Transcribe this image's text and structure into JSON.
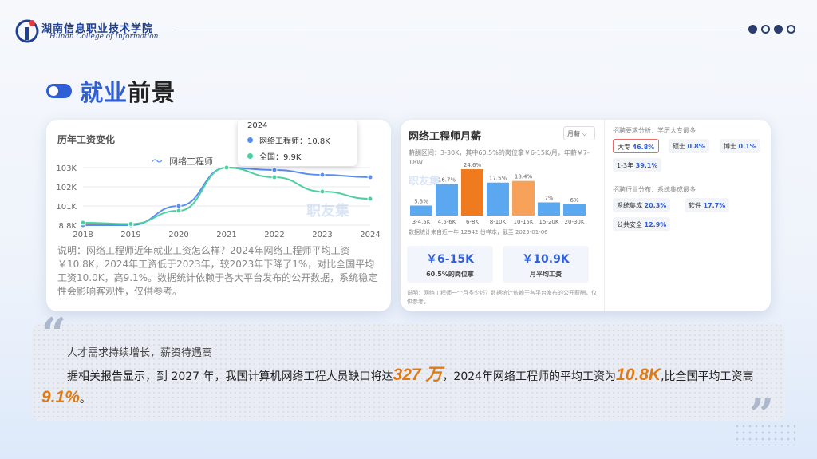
{
  "header": {
    "school_cn": "湖南信息职业技术学院",
    "school_en": "Hunan College of Information",
    "page_dots": 4,
    "active_dot_index": 2
  },
  "title": {
    "highlight": "就业",
    "rest": "前景"
  },
  "salary_trend": {
    "title": "历年工资变化",
    "legend": "网络工程师",
    "tooltip": {
      "year": "2024",
      "row1": "网络工程师：10.8K",
      "row2": "全国：9.9K"
    },
    "watermark": "职友集",
    "description": "说明：网络工程师近年就业工资怎么样？2024年网络工程师平均工资￥10.8K，2024年工资低于2023年，较2023年下降了1%，对比全国平均工资10.0K，高9.1%。数据统计依赖于各大平台发布的公开数据，系统稳定性会影响客观性，仅供参考。"
  },
  "chart_data": [
    {
      "type": "line",
      "title": "历年工资变化",
      "x": [
        "2018",
        "2019",
        "2020",
        "2021",
        "2022",
        "2023",
        "2024"
      ],
      "yticks": [
        "8.8K",
        "101K",
        "102K",
        "103K"
      ],
      "series": [
        {
          "name": "网络工程师",
          "values": [
            8.8,
            8.8,
            9.6,
            11.2,
            11.1,
            10.9,
            10.8
          ],
          "color": "#5b8ef0"
        },
        {
          "name": "全国",
          "values": [
            8.9,
            8.85,
            9.4,
            11.2,
            10.8,
            10.2,
            9.9
          ],
          "color": "#4cd0a0"
        }
      ]
    },
    {
      "type": "bar",
      "title": "网络工程师月薪",
      "categories": [
        "3-4.5K",
        "4.5-6K",
        "6-8K",
        "8-10K",
        "10-15K",
        "15-20K",
        "20-30K"
      ],
      "values": [
        5.3,
        16.7,
        24.6,
        17.5,
        18.4,
        7,
        6
      ],
      "labels": [
        "5.3%",
        "16.7%",
        "24.6%",
        "17.5%",
        "18.4%",
        "7%",
        "6%"
      ],
      "colors": [
        "#5ba7f0",
        "#5ba7f0",
        "#f07a1e",
        "#5ba7f0",
        "#f6a25a",
        "#5ba7f0",
        "#5ba7f0"
      ]
    }
  ],
  "monthly_salary": {
    "title": "网络工程师月薪",
    "select": "月薪 ⌵",
    "subtitle": "薪酬区间：3-30K，其中60.5%的岗位拿￥6-15K/月，年薪￥7-18W",
    "watermark": "职友集",
    "note": "数据统计来自近一年 12942 份样本，截至 2025-01-06",
    "box1_value": "￥6-15K",
    "box1_label": "60.5%的岗位拿",
    "box2_value": "￥10.9K",
    "box2_label": "月平均工资",
    "footer": "说明：网络工程师一个月多少钱？数据统计依赖于各平台发布的公开薪酬，仅供参考。"
  },
  "requirements": {
    "edu_title": "招聘要求分析：学历大专最多",
    "edu_tags": [
      {
        "label": "大专",
        "value": "46.8%"
      },
      {
        "label": "硕士",
        "value": "0.8%"
      },
      {
        "label": "博士",
        "value": "0.1%"
      },
      {
        "label": "1-3年",
        "value": "39.1%"
      }
    ],
    "industry_title": "招聘行业分布：系统集成最多",
    "industry_tags": [
      {
        "label": "系统集成",
        "value": "20.3%"
      },
      {
        "label": "软件",
        "value": "17.7%"
      },
      {
        "label": "公共安全",
        "value": "12.9%"
      }
    ]
  },
  "quote": {
    "line1": "人才需求持续增长，薪资待遇高",
    "p1": "据相关报告显示，到 2027 年，我国计算机网络工程人员缺口将达",
    "n1": "327 万",
    "p2": "，2024年网络工程师的平均工资为",
    "n2": "10.8K",
    "p3": ",比全国平均工资高",
    "n3": "9.1%",
    "p4": "。"
  }
}
